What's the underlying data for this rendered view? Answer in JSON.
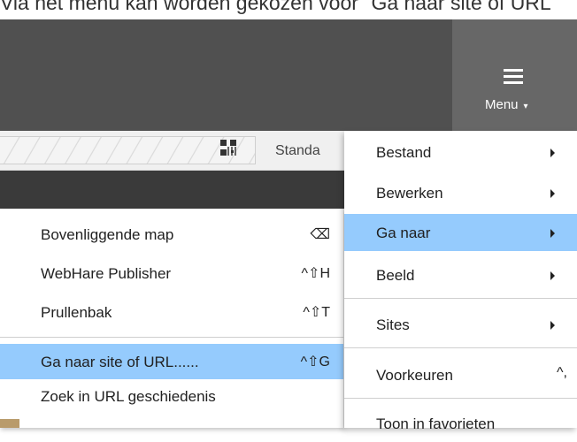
{
  "caption": "Via het menu kan worden gekozen voor \"Ga naar site of URL\"",
  "menu_button": {
    "label": "Menu",
    "caret": "▾"
  },
  "toolbar": {
    "view_label": "Standa"
  },
  "context_menu": {
    "items": [
      {
        "label": "Bovenliggende map",
        "shortcut": "⌫"
      },
      {
        "label": "WebHare Publisher",
        "shortcut": "^⇧H"
      },
      {
        "label": "Prullenbak",
        "shortcut": "^⇧T"
      },
      {
        "label": "Ga naar site of URL......",
        "shortcut": "^⇧G"
      },
      {
        "label": "Zoek in URL geschiedenis",
        "shortcut": ""
      }
    ]
  },
  "main_menu": {
    "items": [
      {
        "label": "Bestand"
      },
      {
        "label": "Bewerken"
      },
      {
        "label": "Ga naar"
      },
      {
        "label": "Beeld"
      },
      {
        "label": "Sites"
      },
      {
        "label": "Voorkeuren",
        "shortcut": "^,"
      },
      {
        "label": "Toon in favorieten"
      }
    ]
  },
  "colors": {
    "highlight": "#95cbfd",
    "topbar": "#505050",
    "menu_button_bg": "#676767"
  }
}
